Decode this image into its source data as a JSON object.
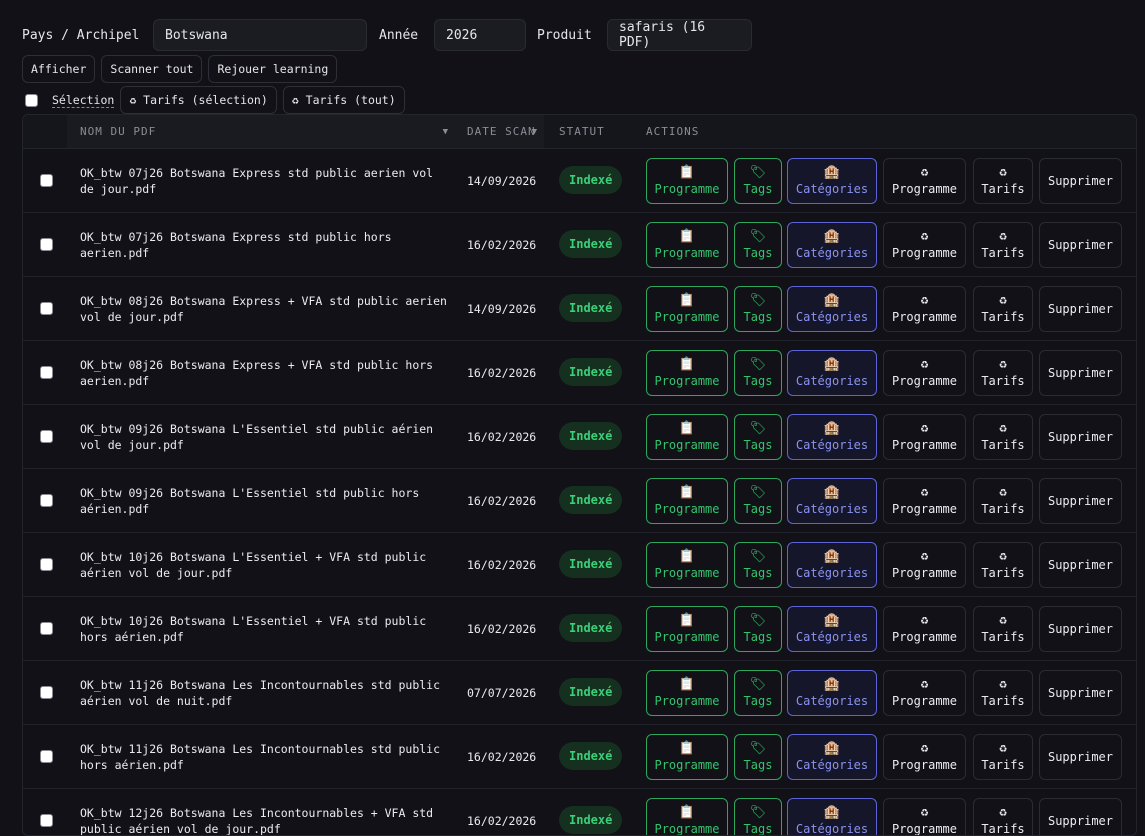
{
  "filters": {
    "pays_label": "Pays / Archipel",
    "pays_value": "Botswana",
    "annee_label": "Année",
    "annee_value": "2026",
    "produit_label": "Produit",
    "produit_value": "safaris (16 PDF)"
  },
  "toolbar": {
    "afficher": "Afficher",
    "scanner": "Scanner tout",
    "rejouer": "Rejouer learning"
  },
  "selection": {
    "label": "Sélection",
    "tarifs_selection": "♻ Tarifs (sélection)",
    "tarifs_tout": "♻ Tarifs (tout)"
  },
  "table": {
    "headers": {
      "nom": "NOM DU PDF",
      "date": "DATE SCAN",
      "statut": "STATUT",
      "actions": "ACTIONS"
    },
    "sort_icon": "▼",
    "actions": {
      "programme_icon": "📋",
      "programme": "Programme",
      "tags_icon": "🏷",
      "tags": "Tags",
      "categories_icon": "🏨",
      "categories": "Catégories",
      "recycle_icon": "♻",
      "programme2": "Programme",
      "tarifs": "Tarifs",
      "supprimer": "Supprimer"
    },
    "rows": [
      {
        "name": "OK_btw 07j26 Botswana Express std public aerien vol de jour.pdf",
        "date": "14/09/2026",
        "status": "Indexé"
      },
      {
        "name": "OK_btw 07j26 Botswana Express std public hors aerien.pdf",
        "date": "16/02/2026",
        "status": "Indexé"
      },
      {
        "name": "OK_btw 08j26 Botswana Express + VFA std public aerien vol de jour.pdf",
        "date": "14/09/2026",
        "status": "Indexé"
      },
      {
        "name": "OK_btw 08j26 Botswana Express + VFA std public hors aerien.pdf",
        "date": "16/02/2026",
        "status": "Indexé"
      },
      {
        "name": "OK_btw 09j26 Botswana L'Essentiel std public aérien vol de jour.pdf",
        "date": "16/02/2026",
        "status": "Indexé"
      },
      {
        "name": "OK_btw 09j26 Botswana L'Essentiel std public hors aérien.pdf",
        "date": "16/02/2026",
        "status": "Indexé"
      },
      {
        "name": "OK_btw 10j26 Botswana L'Essentiel + VFA std public aérien vol de jour.pdf",
        "date": "16/02/2026",
        "status": "Indexé"
      },
      {
        "name": "OK_btw 10j26 Botswana L'Essentiel + VFA std public hors aérien.pdf",
        "date": "16/02/2026",
        "status": "Indexé"
      },
      {
        "name": "OK_btw 11j26 Botswana Les Incontournables std public aérien vol de nuit.pdf",
        "date": "07/07/2026",
        "status": "Indexé"
      },
      {
        "name": "OK_btw 11j26 Botswana Les Incontournables std public hors aérien.pdf",
        "date": "16/02/2026",
        "status": "Indexé"
      },
      {
        "name": "OK_btw 12j26 Botswana Les Incontournables + VFA std public aérien vol de jour.pdf",
        "date": "16/02/2026",
        "status": "Indexé"
      }
    ]
  }
}
